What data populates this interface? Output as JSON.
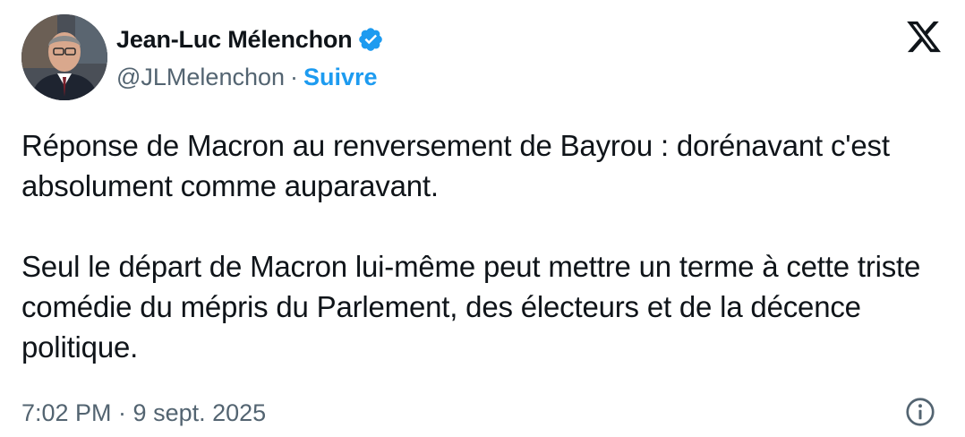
{
  "author": {
    "display_name": "Jean-Luc Mélenchon",
    "handle": "@JLMelenchon",
    "separator": "·",
    "follow_label": "Suivre",
    "verified_icon": "verified-badge-icon"
  },
  "tweet": {
    "paragraph_1": "Réponse de Macron au renversement de Bayrou : dorénavant c'est absolument comme auparavant.",
    "paragraph_2": "Seul le départ de Macron lui-même peut mettre un terme à cette triste comédie du mépris du Parlement, des électeurs et de la décence politique.",
    "timestamp": "7:02 PM · 9 sept. 2025"
  },
  "icons": {
    "brand": "x-logo-icon",
    "info": "info-icon"
  },
  "colors": {
    "accent": "#1d9bf0",
    "text": "#0f1419",
    "secondary": "#536471"
  }
}
